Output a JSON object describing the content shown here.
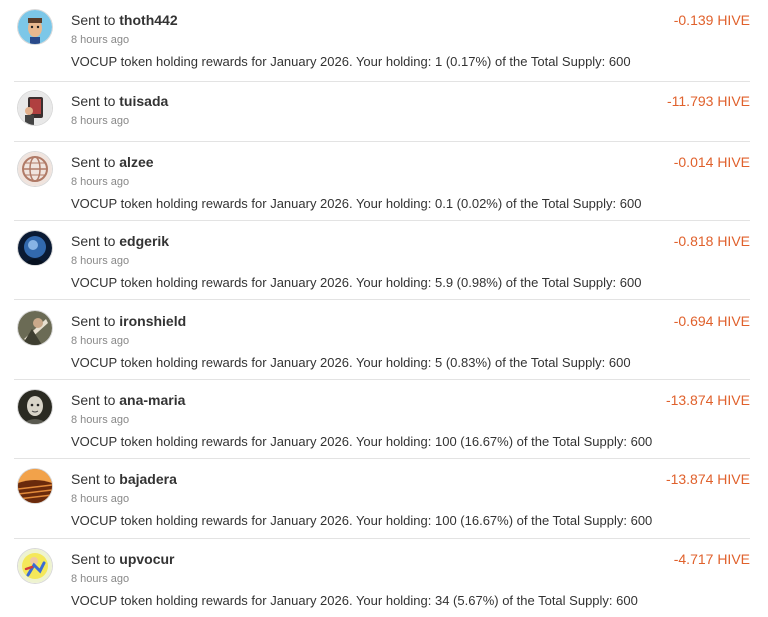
{
  "transfers": [
    {
      "prefix": "Sent to ",
      "to": "thoth442",
      "time": "8 hours ago",
      "memo": "VOCUP token holding rewards for January 2026. Your holding: 1 (0.17%) of the Total Supply: 600",
      "amount": "-0.139 HIVE",
      "avatar_icon": "cartoon-face-avatar-icon",
      "avatar_colors": [
        "#7cc7e8",
        "#5b3d2a"
      ]
    },
    {
      "prefix": "Sent to ",
      "to": "tuisada",
      "time": "8 hours ago",
      "memo": "",
      "amount": "-11.793 HIVE",
      "avatar_icon": "tablet-photo-avatar-icon",
      "avatar_colors": [
        "#e8e8e8",
        "#3a2a2a"
      ]
    },
    {
      "prefix": "Sent to ",
      "to": "alzee",
      "time": "8 hours ago",
      "memo": "VOCUP token holding rewards for January 2026. Your holding: 0.1 (0.02%) of the Total Supply: 600",
      "amount": "-0.014 HIVE",
      "avatar_icon": "globe-avatar-icon",
      "avatar_colors": [
        "#f0e4de",
        "#b07a66"
      ]
    },
    {
      "prefix": "Sent to ",
      "to": "edgerik",
      "time": "8 hours ago",
      "memo": "VOCUP token holding rewards for January 2026. Your holding: 5.9 (0.98%) of the Total Supply: 600",
      "amount": "-0.818 HIVE",
      "avatar_icon": "dark-portrait-avatar-icon",
      "avatar_colors": [
        "#0a1a33",
        "#3a78c4"
      ]
    },
    {
      "prefix": "Sent to ",
      "to": "ironshield",
      "time": "8 hours ago",
      "memo": "VOCUP token holding rewards for January 2026. Your holding: 5 (0.83%) of the Total Supply: 600",
      "amount": "-0.694 HIVE",
      "avatar_icon": "warrior-avatar-icon",
      "avatar_colors": [
        "#6b6b55",
        "#e8e0d0"
      ]
    },
    {
      "prefix": "Sent to ",
      "to": "ana-maria",
      "time": "8 hours ago",
      "memo": "VOCUP token holding rewards for January 2026. Your holding: 100 (16.67%) of the Total Supply: 600",
      "amount": "-13.874 HIVE",
      "avatar_icon": "portrait-avatar-icon",
      "avatar_colors": [
        "#2a2a22",
        "#d8d4c8"
      ]
    },
    {
      "prefix": "Sent to ",
      "to": "bajadera",
      "time": "8 hours ago",
      "memo": "VOCUP token holding rewards for January 2026. Your holding: 100 (16.67%) of the Total Supply: 600",
      "amount": "-13.874 HIVE",
      "avatar_icon": "landscape-avatar-icon",
      "avatar_colors": [
        "#c4651c",
        "#6a2a0c"
      ]
    },
    {
      "prefix": "Sent to ",
      "to": "upvocur",
      "time": "8 hours ago",
      "memo": "VOCUP token holding rewards for January 2026. Your holding: 34 (5.67%) of the Total Supply: 600",
      "amount": "-4.717 HIVE",
      "avatar_icon": "cartoon-figure-avatar-icon",
      "avatar_colors": [
        "#f4e85a",
        "#3a6bd4"
      ]
    }
  ]
}
